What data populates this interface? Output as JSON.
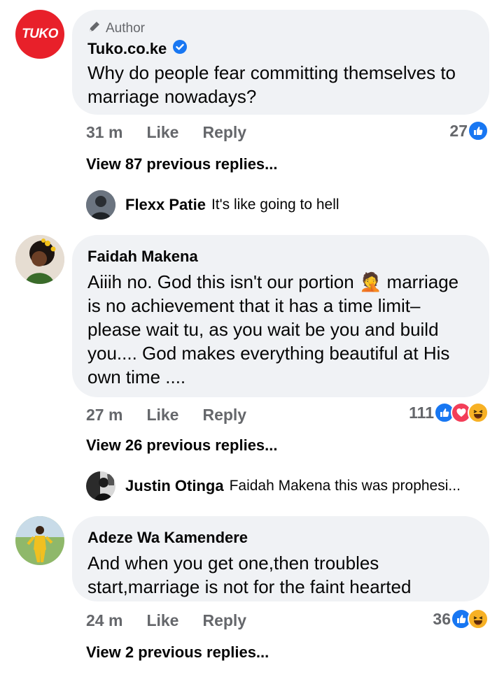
{
  "comments": [
    {
      "author_badge": "Author",
      "name": "Tuko.co.ke",
      "avatar_logo_text": "TUKO",
      "verified": true,
      "text": "Why do people fear committing themselves to marriage nowadays?",
      "time": "31 m",
      "like_label": "Like",
      "reply_label": "Reply",
      "reaction_count": "27",
      "reactions": [
        "like-icon"
      ],
      "view_replies": "View 87 previous replies...",
      "reply_preview": {
        "name": "Flexx Patie",
        "text": "It's like going to hell"
      }
    },
    {
      "name": "Faidah Makena",
      "text": "Aiiih no. God this isn't our portion 🤦 marriage is no achievement that it has a time limit– please wait tu, as you wait be you and build you.... God makes everything beautiful at His own time ....",
      "time": "27 m",
      "like_label": "Like",
      "reply_label": "Reply",
      "reaction_count": "111",
      "reactions": [
        "like-icon",
        "love-icon",
        "haha-icon"
      ],
      "view_replies": "View 26 previous replies...",
      "reply_preview": {
        "name": "Justin Otinga",
        "text": "Faidah Makena this was prophesi..."
      }
    },
    {
      "name": "Adeze Wa Kamendere",
      "text": "And when you get one,then troubles start,marriage is not for the faint hearted",
      "time": "24 m",
      "like_label": "Like",
      "reply_label": "Reply",
      "reaction_count": "36",
      "reactions": [
        "like-icon",
        "haha-icon"
      ],
      "view_replies": "View 2 previous replies..."
    }
  ],
  "colors": {
    "bubble_bg": "#f0f2f5",
    "meta_text": "#65676b",
    "like_blue": "#1877f2",
    "love_red": "#f33e58",
    "haha_yellow": "#f7b125",
    "tuko_red": "#e8202a"
  }
}
